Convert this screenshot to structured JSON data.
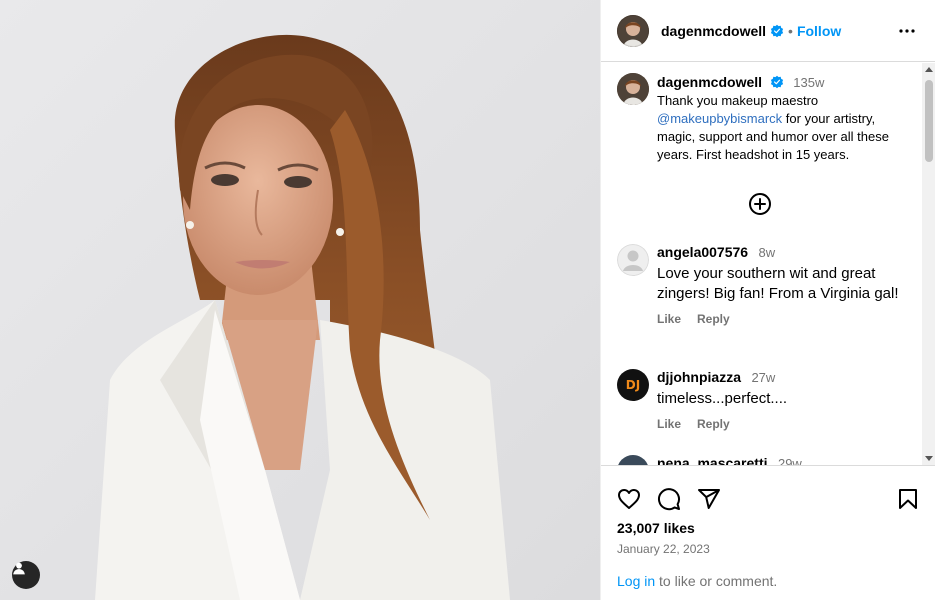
{
  "post": {
    "author": "dagenmcdowell",
    "follow_label": "Follow",
    "separator": "•"
  },
  "caption": {
    "username": "dagenmcdowell",
    "time": "135w",
    "text_before": "Thank you makeup maestro ",
    "mention": "@makeupbybismarck",
    "text_after": " for your artistry, magic, support and humor over all these years. First headshot in 15 years."
  },
  "comments": [
    {
      "username": "angela007576",
      "time": "8w",
      "text": "Love your southern wit and great zingers! Big fan! From a Virginia gal!",
      "like": "Like",
      "reply": "Reply"
    },
    {
      "username": "djjohnpiazza",
      "time": "27w",
      "text": "timeless...perfect....",
      "like": "Like",
      "reply": "Reply",
      "avatar_text": "DJ"
    },
    {
      "username": "nena_mascaretti",
      "time": "29w"
    }
  ],
  "footer": {
    "likes": "23,007 likes",
    "date": "January 22, 2023",
    "login_link": "Log in",
    "login_rest": " to like or comment."
  },
  "colors": {
    "link": "#0095f6",
    "secondary_text": "#737373",
    "verified": "#0095f6"
  },
  "icons": [
    "user-tag-icon",
    "verified-icon",
    "more-options-icon",
    "load-more-icon",
    "heart-icon",
    "comment-icon",
    "share-icon",
    "bookmark-icon"
  ]
}
